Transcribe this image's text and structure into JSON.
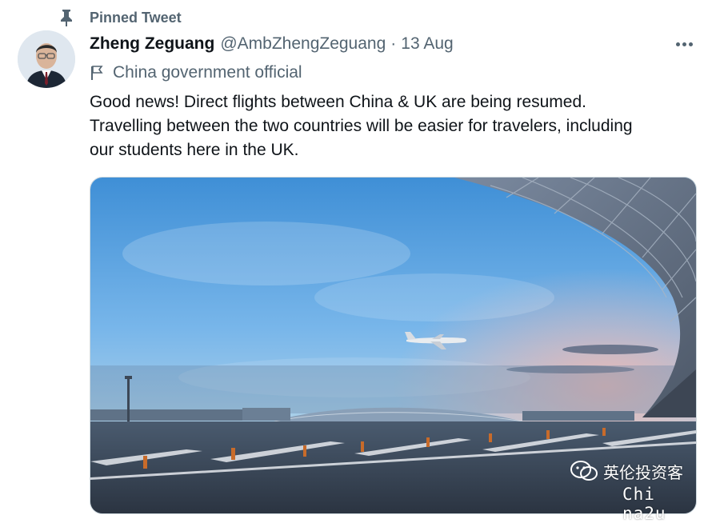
{
  "pinned": {
    "label": "Pinned Tweet",
    "icon": "pin-icon"
  },
  "author": {
    "name": "Zheng Zeguang",
    "handle": "@AmbZhengZeguang",
    "separator": "·",
    "date": "13 Aug",
    "label": "China government official",
    "label_icon": "flag-icon",
    "avatar_icon": "avatar"
  },
  "tweet": {
    "lines": [
      "Good news! Direct flights between China & UK are being resumed.",
      "Travelling between the two countries will be easier for travelers, including",
      "our students here in the UK."
    ]
  },
  "media": {
    "description_icon": "airport-photo"
  },
  "watermark": {
    "cn": "英伦投资客",
    "en": "Chi na2u"
  },
  "colors": {
    "text": "#0f1419",
    "secondary": "#536471",
    "border": "#cfd9de"
  }
}
